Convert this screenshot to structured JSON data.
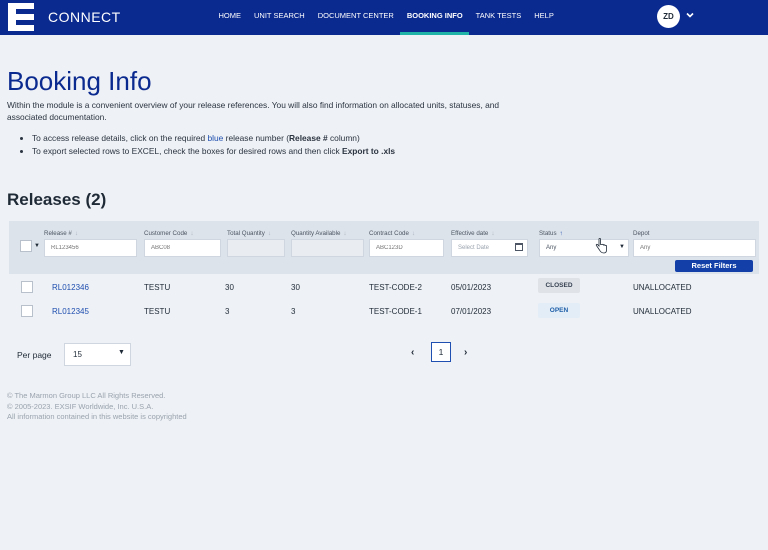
{
  "header": {
    "brand": "CONNECT",
    "nav": [
      "HOME",
      "UNIT SEARCH",
      "DOCUMENT CENTER",
      "BOOKING INFO",
      "TANK TESTS",
      "HELP"
    ],
    "active_nav": "BOOKING INFO",
    "user_initials": "ZD"
  },
  "page": {
    "title": "Booking Info",
    "intro": "Within the module is a convenient overview of your release references. You will also find information on allocated units, statuses, and associated documentation.",
    "bullet1_a": "To access release details, click on the required ",
    "bullet1_blue": "blue",
    "bullet1_b": " release number (",
    "bullet1_bold": "Release #",
    "bullet1_c": " column)",
    "bullet2_a": "To export selected rows to EXCEL, check the boxes for desired rows and then click ",
    "bullet2_bold": "Export to .xls"
  },
  "releases": {
    "title": "Releases (2)",
    "columns": [
      "Release #",
      "Customer Code",
      "Total Quantity",
      "Quantity Available",
      "Contract Code",
      "Effective date",
      "Status",
      "Depot"
    ],
    "placeholders": {
      "release": "RL123456",
      "customer": "ABC08",
      "contract": "ABC123D",
      "date": "Select Date",
      "status": "Any",
      "depot": "Any"
    },
    "reset_label": "Reset Filters",
    "rows": [
      {
        "release": "RL012346",
        "customer": "TESTU",
        "total": "30",
        "available": "30",
        "contract": "TEST-CODE-2",
        "date": "05/01/2023",
        "status": "CLOSED",
        "depot": "UNALLOCATED"
      },
      {
        "release": "RL012345",
        "customer": "TESTU",
        "total": "3",
        "available": "3",
        "contract": "TEST-CODE-1",
        "date": "07/01/2023",
        "status": "OPEN",
        "depot": "UNALLOCATED"
      }
    ]
  },
  "pagination": {
    "per_page_label": "Per page",
    "per_page_value": "15",
    "current_page": "1"
  },
  "footer": {
    "line1": "© The Marmon Group LLC All Rights Reserved.",
    "line2": "© 2005-2023. EXSIF Worldwide, Inc. U.S.A.",
    "line3": "All information contained in this website is copyrighted"
  },
  "colors": {
    "header_bg": "#0b2a8f",
    "active_underline": "#1fb3a7",
    "link": "#1f4fb0",
    "button": "#1340a8"
  },
  "icons": [
    "calendar-icon",
    "chevron-down-icon",
    "chevron-left-icon",
    "chevron-right-icon",
    "sort-up-icon",
    "hand-cursor-icon"
  ]
}
